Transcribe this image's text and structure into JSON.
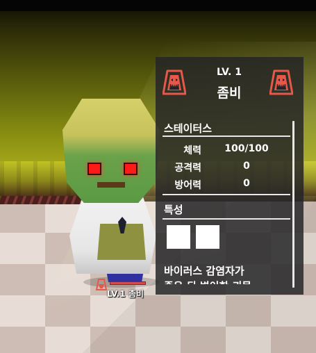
{
  "monster": {
    "level_label": "LV. 1",
    "name": "좀비",
    "portrait_icon": "screaming-monster-icon",
    "accent_color": "#e8584a"
  },
  "stats": {
    "title": "스테이터스",
    "rows": [
      {
        "label": "체력",
        "value": "100/100"
      },
      {
        "label": "공격력",
        "value": "0"
      },
      {
        "label": "방어력",
        "value": "0"
      }
    ]
  },
  "traits": {
    "title": "특성",
    "slot_count": 2
  },
  "description": {
    "lines": [
      "바이러스 감염자가",
      "죽은 뒤 변이한 괴물"
    ]
  },
  "nameplate": {
    "label": "LV.1 좀비",
    "health_fraction": 1.0
  }
}
